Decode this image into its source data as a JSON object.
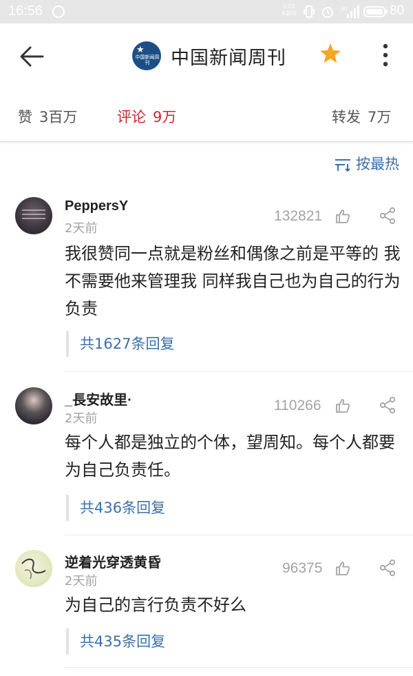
{
  "status_bar": {
    "time": "16:56",
    "net_speed_value": "0.03",
    "net_speed_unit": "KB/S",
    "network": "4G",
    "battery": "80"
  },
  "header": {
    "title": "中国新闻周刊",
    "logo_text": "中国新闻周刊",
    "accent_color": "#f5a623",
    "logo_color": "#1c4f86"
  },
  "stats": {
    "likes_label": "赞",
    "likes_count": "3百万",
    "comments_label": "评论",
    "comments_count": "9万",
    "reposts_label": "转发",
    "reposts_count": "7万",
    "active_color": "#c8262d"
  },
  "sort": {
    "label": "按最热",
    "icon": "sort-icon"
  },
  "comments": [
    {
      "username": "PeppersY",
      "time": "2天前",
      "likes": "132821",
      "text": "我很赞同一点就是粉丝和偶像之前是平等的 我不需要他来管理我 同样我自己也为自己的行为负责",
      "replies": "共1627条回复"
    },
    {
      "username": "_長安故里·",
      "time": "2天前",
      "likes": "110266",
      "text": "每个人都是独立的个体，望周知。每个人都要为自己负责任。",
      "replies": "共436条回复"
    },
    {
      "username": "逆着光穿透黄昏",
      "time": "2天前",
      "likes": "96375",
      "text": "为自己的言行负责不好么",
      "replies": "共435条回复"
    }
  ],
  "link_color": "#3b6fa8"
}
